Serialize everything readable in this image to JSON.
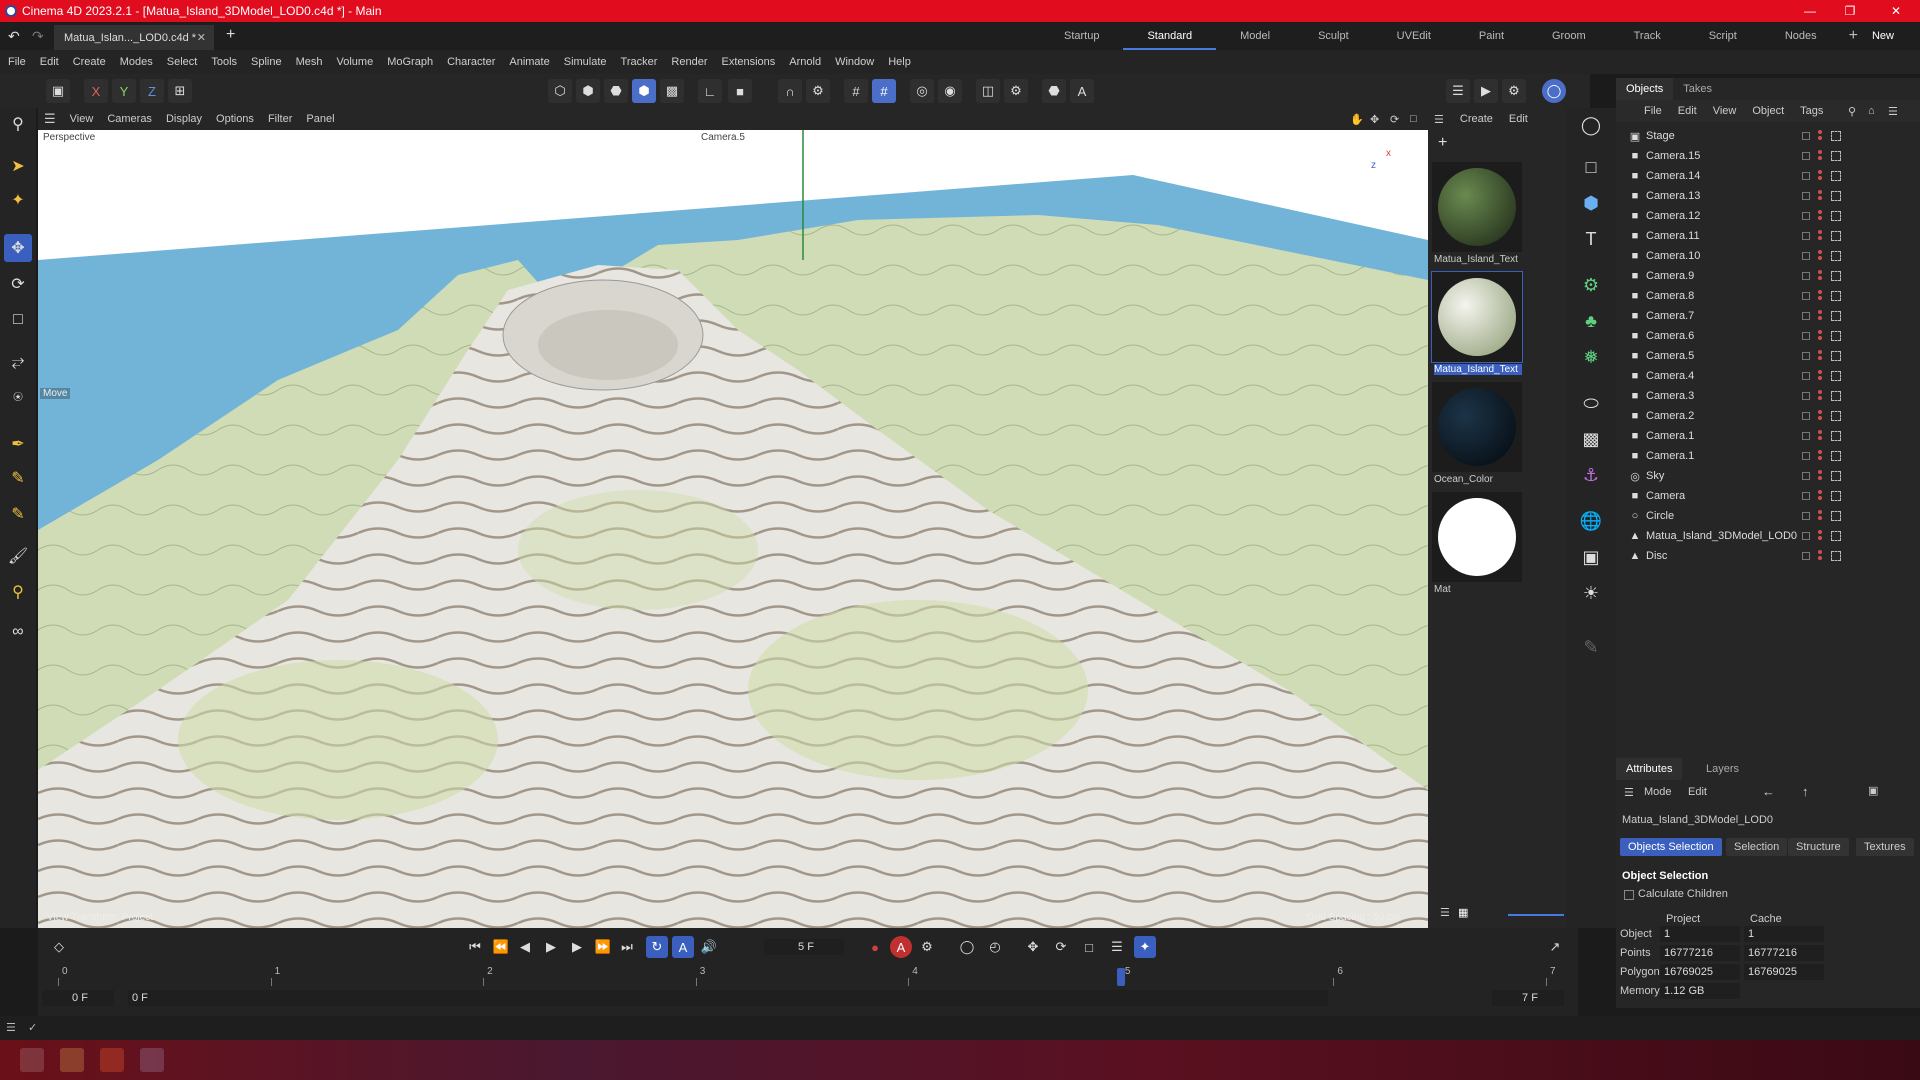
{
  "window": {
    "title": "Cinema 4D 2023.2.1 - [Matua_Island_3DModel_LOD0.c4d *] - Main",
    "doc_tab": "Matua_Islan..._LOD0.c4d *",
    "brand_color": "#e10d1e",
    "accent_color": "#3a5fbf"
  },
  "layouts": {
    "items": [
      "Startup",
      "Standard",
      "Model",
      "Sculpt",
      "UVEdit",
      "Paint",
      "Groom",
      "Track",
      "Script",
      "Nodes"
    ],
    "active": "Standard",
    "new_layouts_label": "New Layouts"
  },
  "menu": [
    "File",
    "Edit",
    "Create",
    "Modes",
    "Select",
    "Tools",
    "Spline",
    "Mesh",
    "Volume",
    "MoGraph",
    "Character",
    "Animate",
    "Simulate",
    "Tracker",
    "Render",
    "Extensions",
    "Arnold",
    "Window",
    "Help"
  ],
  "toolbar": {
    "axis_x": "X",
    "axis_y": "Y",
    "axis_z": "Z"
  },
  "viewport": {
    "menu": [
      "View",
      "Cameras",
      "Display",
      "Options",
      "Filter",
      "Panel"
    ],
    "label_perspective": "Perspective",
    "label_camera": "Camera.5",
    "label_move": "Move",
    "label_transform": "View Transform: Project",
    "label_grid": "Grid Spacing : 50 cm",
    "axis_x": "x",
    "axis_z": "z"
  },
  "materials": {
    "menu": [
      "Create",
      "Edit"
    ],
    "items": [
      {
        "name": "Matua_Island_Text"
      },
      {
        "name": "Matua_Island_Text"
      },
      {
        "name": "Ocean_Color"
      },
      {
        "name": "Mat"
      }
    ]
  },
  "objects": {
    "tabs": [
      "Objects",
      "Takes"
    ],
    "menu": [
      "File",
      "Edit",
      "View",
      "Object",
      "Tags"
    ],
    "items": [
      {
        "name": "Stage",
        "icon": "stage-icon"
      },
      {
        "name": "Camera.15",
        "icon": "camera-icon"
      },
      {
        "name": "Camera.14",
        "icon": "camera-icon"
      },
      {
        "name": "Camera.13",
        "icon": "camera-icon"
      },
      {
        "name": "Camera.12",
        "icon": "camera-icon"
      },
      {
        "name": "Camera.11",
        "icon": "camera-icon"
      },
      {
        "name": "Camera.10",
        "icon": "camera-icon"
      },
      {
        "name": "Camera.9",
        "icon": "camera-icon"
      },
      {
        "name": "Camera.8",
        "icon": "camera-icon"
      },
      {
        "name": "Camera.7",
        "icon": "camera-icon"
      },
      {
        "name": "Camera.6",
        "icon": "camera-icon"
      },
      {
        "name": "Camera.5",
        "icon": "camera-icon"
      },
      {
        "name": "Camera.4",
        "icon": "camera-icon"
      },
      {
        "name": "Camera.3",
        "icon": "camera-icon"
      },
      {
        "name": "Camera.2",
        "icon": "camera-icon"
      },
      {
        "name": "Camera.1",
        "icon": "camera-icon"
      },
      {
        "name": "Camera.1",
        "icon": "camera-icon"
      },
      {
        "name": "Sky",
        "icon": "sky-icon"
      },
      {
        "name": "Camera",
        "icon": "camera-icon"
      },
      {
        "name": "Circle",
        "icon": "circle-icon"
      },
      {
        "name": "Matua_Island_3DModel_LOD0",
        "icon": "polygon-object-icon"
      },
      {
        "name": "Disc",
        "icon": "polygon-object-icon"
      }
    ]
  },
  "attributes": {
    "tabs": [
      "Attributes",
      "Layers"
    ],
    "menu": [
      "Mode",
      "Edit"
    ],
    "object_name": "Matua_Island_3DModel_LOD0",
    "subtabs": [
      "Objects Selection",
      "Selection",
      "Structure",
      "Textures"
    ],
    "section": "Object Selection",
    "calc_children": "Calculate Children",
    "col_project": "Project",
    "col_cache": "Cache",
    "rows": [
      {
        "label": "Object",
        "project": "1",
        "cache": "1"
      },
      {
        "label": "Points",
        "project": "16777216",
        "cache": "16777216"
      },
      {
        "label": "Polygons",
        "project": "16769025",
        "cache": "16769025"
      },
      {
        "label": "Memory",
        "project": "1.12 GB",
        "cache": ""
      }
    ]
  },
  "timeline": {
    "current_frame": "5 F",
    "ticks": [
      "0",
      "1",
      "2",
      "3",
      "4",
      "5",
      "6",
      "7"
    ],
    "playhead": 5,
    "start": "0 F",
    "start2": "0 F",
    "end": "7 F",
    "end2": "7 F",
    "max_frame": 7
  }
}
